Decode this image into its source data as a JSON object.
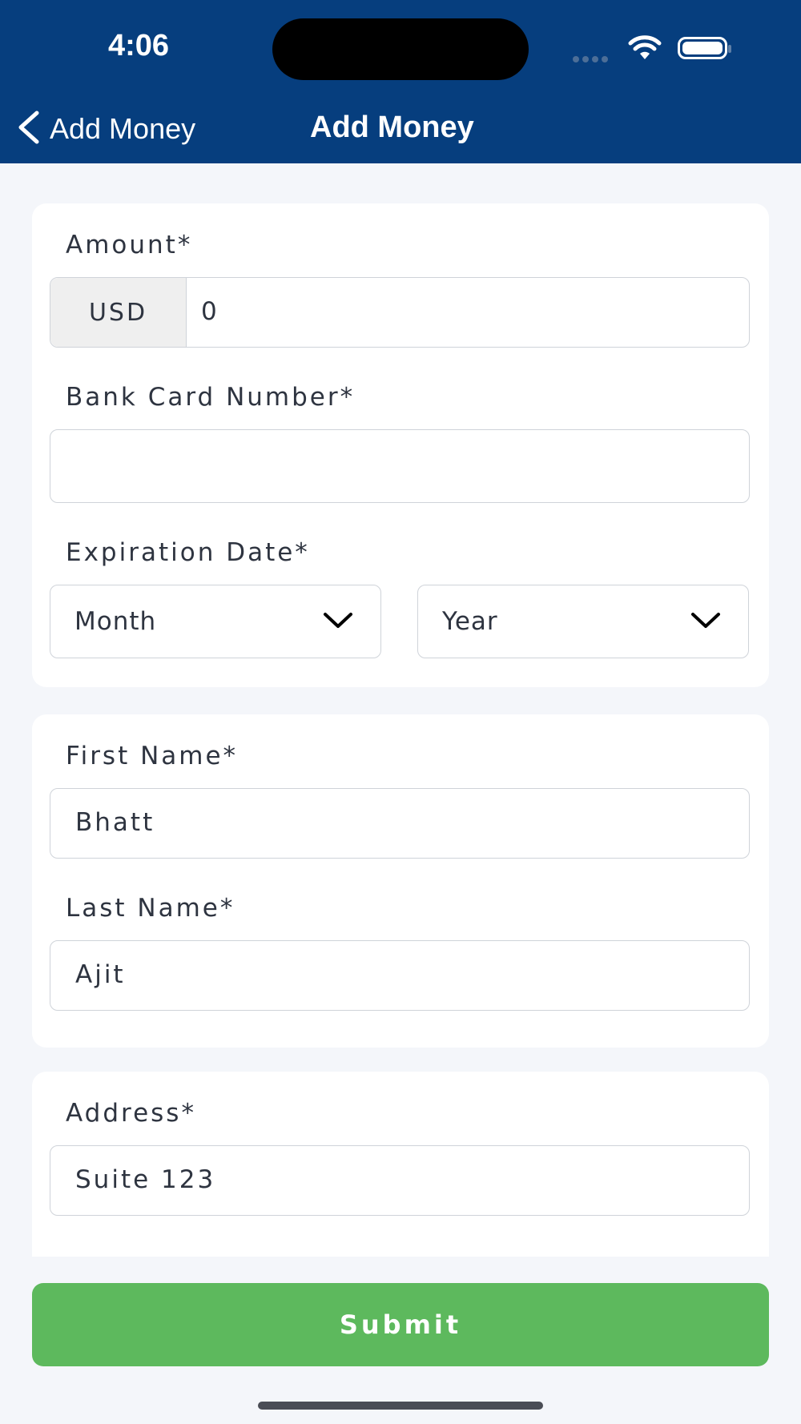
{
  "status_bar": {
    "time": "4:06"
  },
  "nav": {
    "back_label": "Add Money",
    "title": "Add Money"
  },
  "form": {
    "amount": {
      "label": "Amount*",
      "currency": "USD",
      "value": "0"
    },
    "card_number": {
      "label": "Bank Card Number*",
      "value": ""
    },
    "expiration": {
      "label": "Expiration Date*",
      "month": "Month",
      "year": "Year"
    },
    "first_name": {
      "label": "First Name*",
      "value": "Bhatt"
    },
    "last_name": {
      "label": "Last Name*",
      "value": "Ajit"
    },
    "address": {
      "label": "Address*",
      "value": "Suite 123"
    },
    "submit_label": "Submit"
  },
  "colors": {
    "header": "#063e7e",
    "submit": "#5db95d",
    "background": "#f4f6fa"
  }
}
